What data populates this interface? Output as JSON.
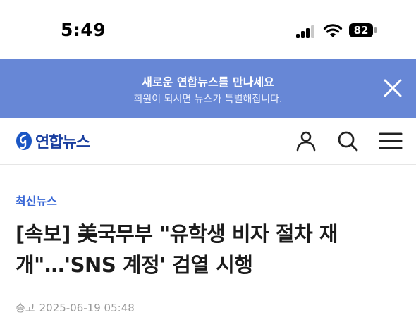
{
  "status_bar": {
    "time": "5:49",
    "battery": "82"
  },
  "promo": {
    "title": "새로운 연합뉴스를 만나세요",
    "subtitle": "회원이 되시면 뉴스가 특별해집니다."
  },
  "header": {
    "logo_text": "연합뉴스",
    "brand_color": "#1a3f9f"
  },
  "article": {
    "category": "최신뉴스",
    "headline": "[속보] 美국무부 \"유학생 비자 절차 재개\"…'SNS 계정' 검열 시행",
    "meta_label": "송고",
    "timestamp": "2025-06-19 05:48"
  },
  "colors": {
    "promo_bg": "#6787d6",
    "category": "#3a68d6"
  },
  "icons": [
    "signal-icon",
    "wifi-icon",
    "battery-icon",
    "close-icon",
    "logo-icon",
    "user-icon",
    "search-icon",
    "menu-icon"
  ]
}
